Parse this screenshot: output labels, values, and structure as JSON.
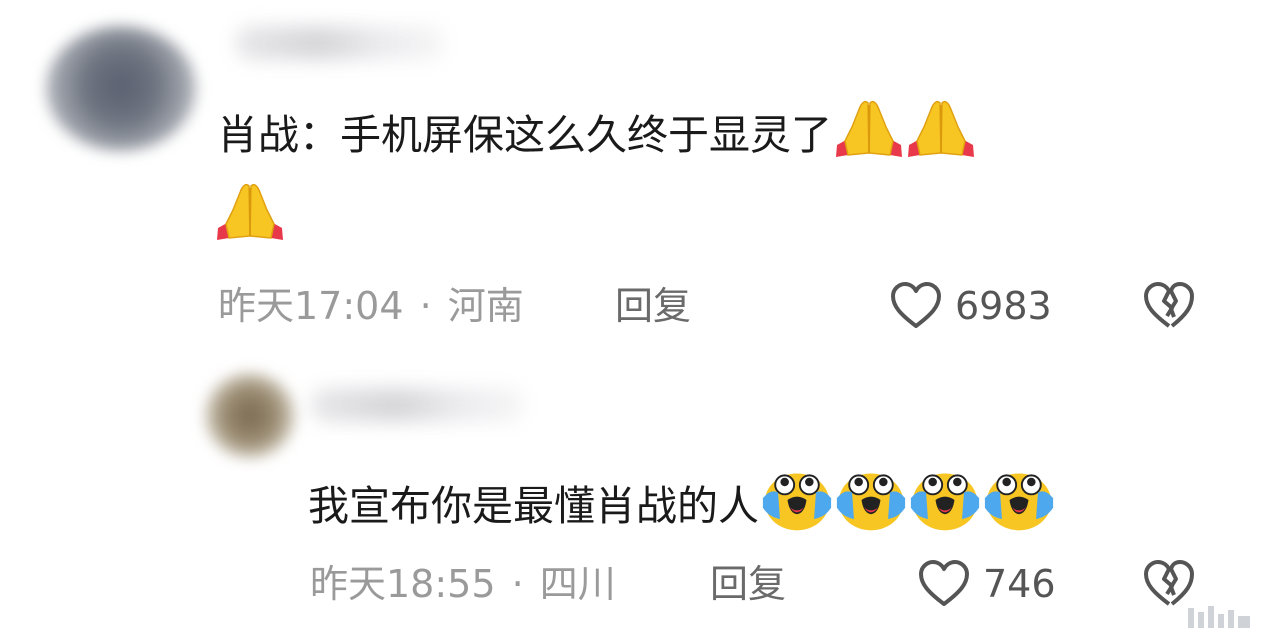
{
  "comments": [
    {
      "text": "肖战：手机屏保这么久终于显灵了",
      "emojis": [
        "folded-hands-icon",
        "folded-hands-icon",
        "folded-hands-icon"
      ],
      "time": "昨天17:04",
      "separator": "·",
      "location": "河南",
      "reply_label": "回复",
      "likes": "6983"
    },
    {
      "text": "我宣布你是最懂肖战的人",
      "emojis": [
        "loudly-crying-face-icon",
        "loudly-crying-face-icon",
        "loudly-crying-face-icon",
        "loudly-crying-face-icon"
      ],
      "time": "昨天18:55",
      "separator": "·",
      "location": "四川",
      "reply_label": "回复",
      "likes": "746"
    }
  ],
  "colors": {
    "text": "#1a1a1a",
    "meta": "#9a9a9a",
    "icon": "#555555",
    "emoji_yellow": "#f7c623",
    "emoji_red": "#e8394a",
    "tear_blue": "#4ea8ee"
  }
}
